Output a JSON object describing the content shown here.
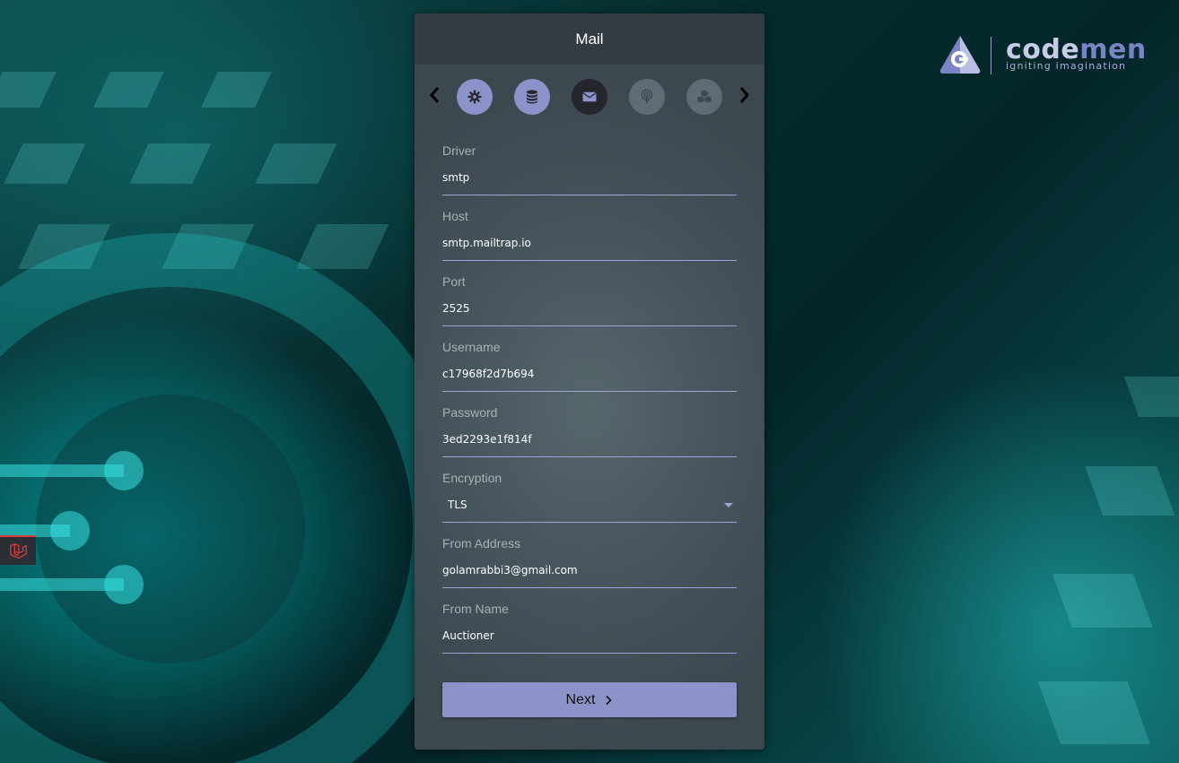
{
  "window": {
    "title": "Mail"
  },
  "brand": {
    "name_part1": "code",
    "name_part2": "men",
    "tagline": "igniting imagination"
  },
  "steps": [
    {
      "name": "settings",
      "icon": "gear-icon",
      "state": "done"
    },
    {
      "name": "database",
      "icon": "database-icon",
      "state": "done"
    },
    {
      "name": "mail",
      "icon": "envelope-icon",
      "state": "active"
    },
    {
      "name": "broadcast",
      "icon": "podcast-icon",
      "state": "pending"
    },
    {
      "name": "modules",
      "icon": "cubes-icon",
      "state": "pending"
    }
  ],
  "form": {
    "driver": {
      "label": "Driver",
      "value": "smtp"
    },
    "host": {
      "label": "Host",
      "value": "smtp.mailtrap.io"
    },
    "port": {
      "label": "Port",
      "value": "2525"
    },
    "username": {
      "label": "Username",
      "value": "c17968f2d7b694"
    },
    "password": {
      "label": "Password",
      "value": "3ed2293e1f814f"
    },
    "encryption": {
      "label": "Encryption",
      "value": "TLS"
    },
    "from_address": {
      "label": "From Address",
      "value": "golamrabbi3@gmail.com"
    },
    "from_name": {
      "label": "From Name",
      "value": "Auctioner"
    }
  },
  "actions": {
    "next_label": "Next"
  },
  "colors": {
    "accent": "#8b93c9",
    "header": "#343b42",
    "active_step": "#25252c",
    "pending_step": "#5f6c74",
    "laravel": "#e23a3a"
  }
}
